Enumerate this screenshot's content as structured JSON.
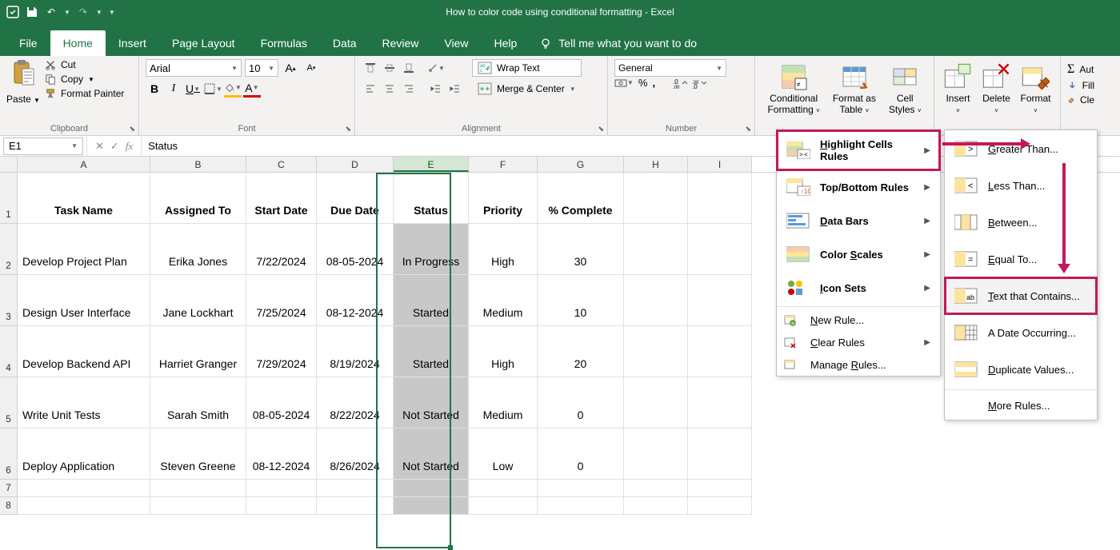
{
  "window_title": "How to color code using conditional formatting  -  Excel",
  "tabs": {
    "file": "File",
    "home": "Home",
    "insert": "Insert",
    "page_layout": "Page Layout",
    "formulas": "Formulas",
    "data": "Data",
    "review": "Review",
    "view": "View",
    "help": "Help",
    "tell_me": "Tell me what you want to do"
  },
  "ribbon": {
    "clipboard": {
      "label": "Clipboard",
      "paste": "Paste",
      "cut": "Cut",
      "copy": "Copy",
      "format_painter": "Format Painter"
    },
    "font": {
      "label": "Font",
      "name": "Arial",
      "size": "10"
    },
    "alignment": {
      "label": "Alignment",
      "wrap": "Wrap Text",
      "merge": "Merge & Center"
    },
    "number": {
      "label": "Number",
      "format": "General"
    },
    "styles": {
      "cf": "Conditional",
      "cf2": "Formatting",
      "fat": "Format as",
      "fat2": "Table",
      "cs": "Cell",
      "cs2": "Styles"
    },
    "cells": {
      "insert": "Insert",
      "delete": "Delete",
      "format": "Format"
    },
    "editing": {
      "autosum": "Aut",
      "fill": "Fill",
      "clear": "Cle"
    }
  },
  "name_box": "E1",
  "formula": "Status",
  "cols": [
    "A",
    "B",
    "C",
    "D",
    "E",
    "F",
    "G",
    "H",
    "I"
  ],
  "rows": [
    "1",
    "2",
    "3",
    "4",
    "5",
    "6",
    "7",
    "8"
  ],
  "headers": [
    "Task Name",
    "Assigned To",
    "Start Date",
    "Due Date",
    "Status",
    "Priority",
    "% Complete"
  ],
  "data_rows": [
    [
      "Develop Project Plan",
      "Erika Jones",
      "7/22/2024",
      "08-05-2024",
      "In Progress",
      "High",
      "30"
    ],
    [
      "Design User Interface",
      "Jane Lockhart",
      "7/25/2024",
      "08-12-2024",
      "Started",
      "Medium",
      "10"
    ],
    [
      "Develop Backend API",
      "Harriet Granger",
      "7/29/2024",
      "8/19/2024",
      "Started",
      "High",
      "20"
    ],
    [
      "Write Unit Tests",
      "Sarah Smith",
      "08-05-2024",
      "8/22/2024",
      "Not Started",
      "Medium",
      "0"
    ],
    [
      "Deploy Application",
      "Steven Greene",
      "08-12-2024",
      "8/26/2024",
      "Not Started",
      "Low",
      "0"
    ]
  ],
  "cf_menu": {
    "highlight": "Highlight Cells Rules",
    "topbottom": "Top/Bottom Rules",
    "databars": "Data Bars",
    "colorscales": "Color Scales",
    "iconsets": "Icon Sets",
    "newrule": "New Rule...",
    "clear": "Clear Rules",
    "manage": "Manage Rules..."
  },
  "sub_menu": {
    "greater": "Greater Than...",
    "less": "Less Than...",
    "between": "Between...",
    "equal": "Equal To...",
    "text": "Text that Contains...",
    "date": "A Date Occurring...",
    "dup": "Duplicate Values...",
    "more": "More Rules..."
  }
}
